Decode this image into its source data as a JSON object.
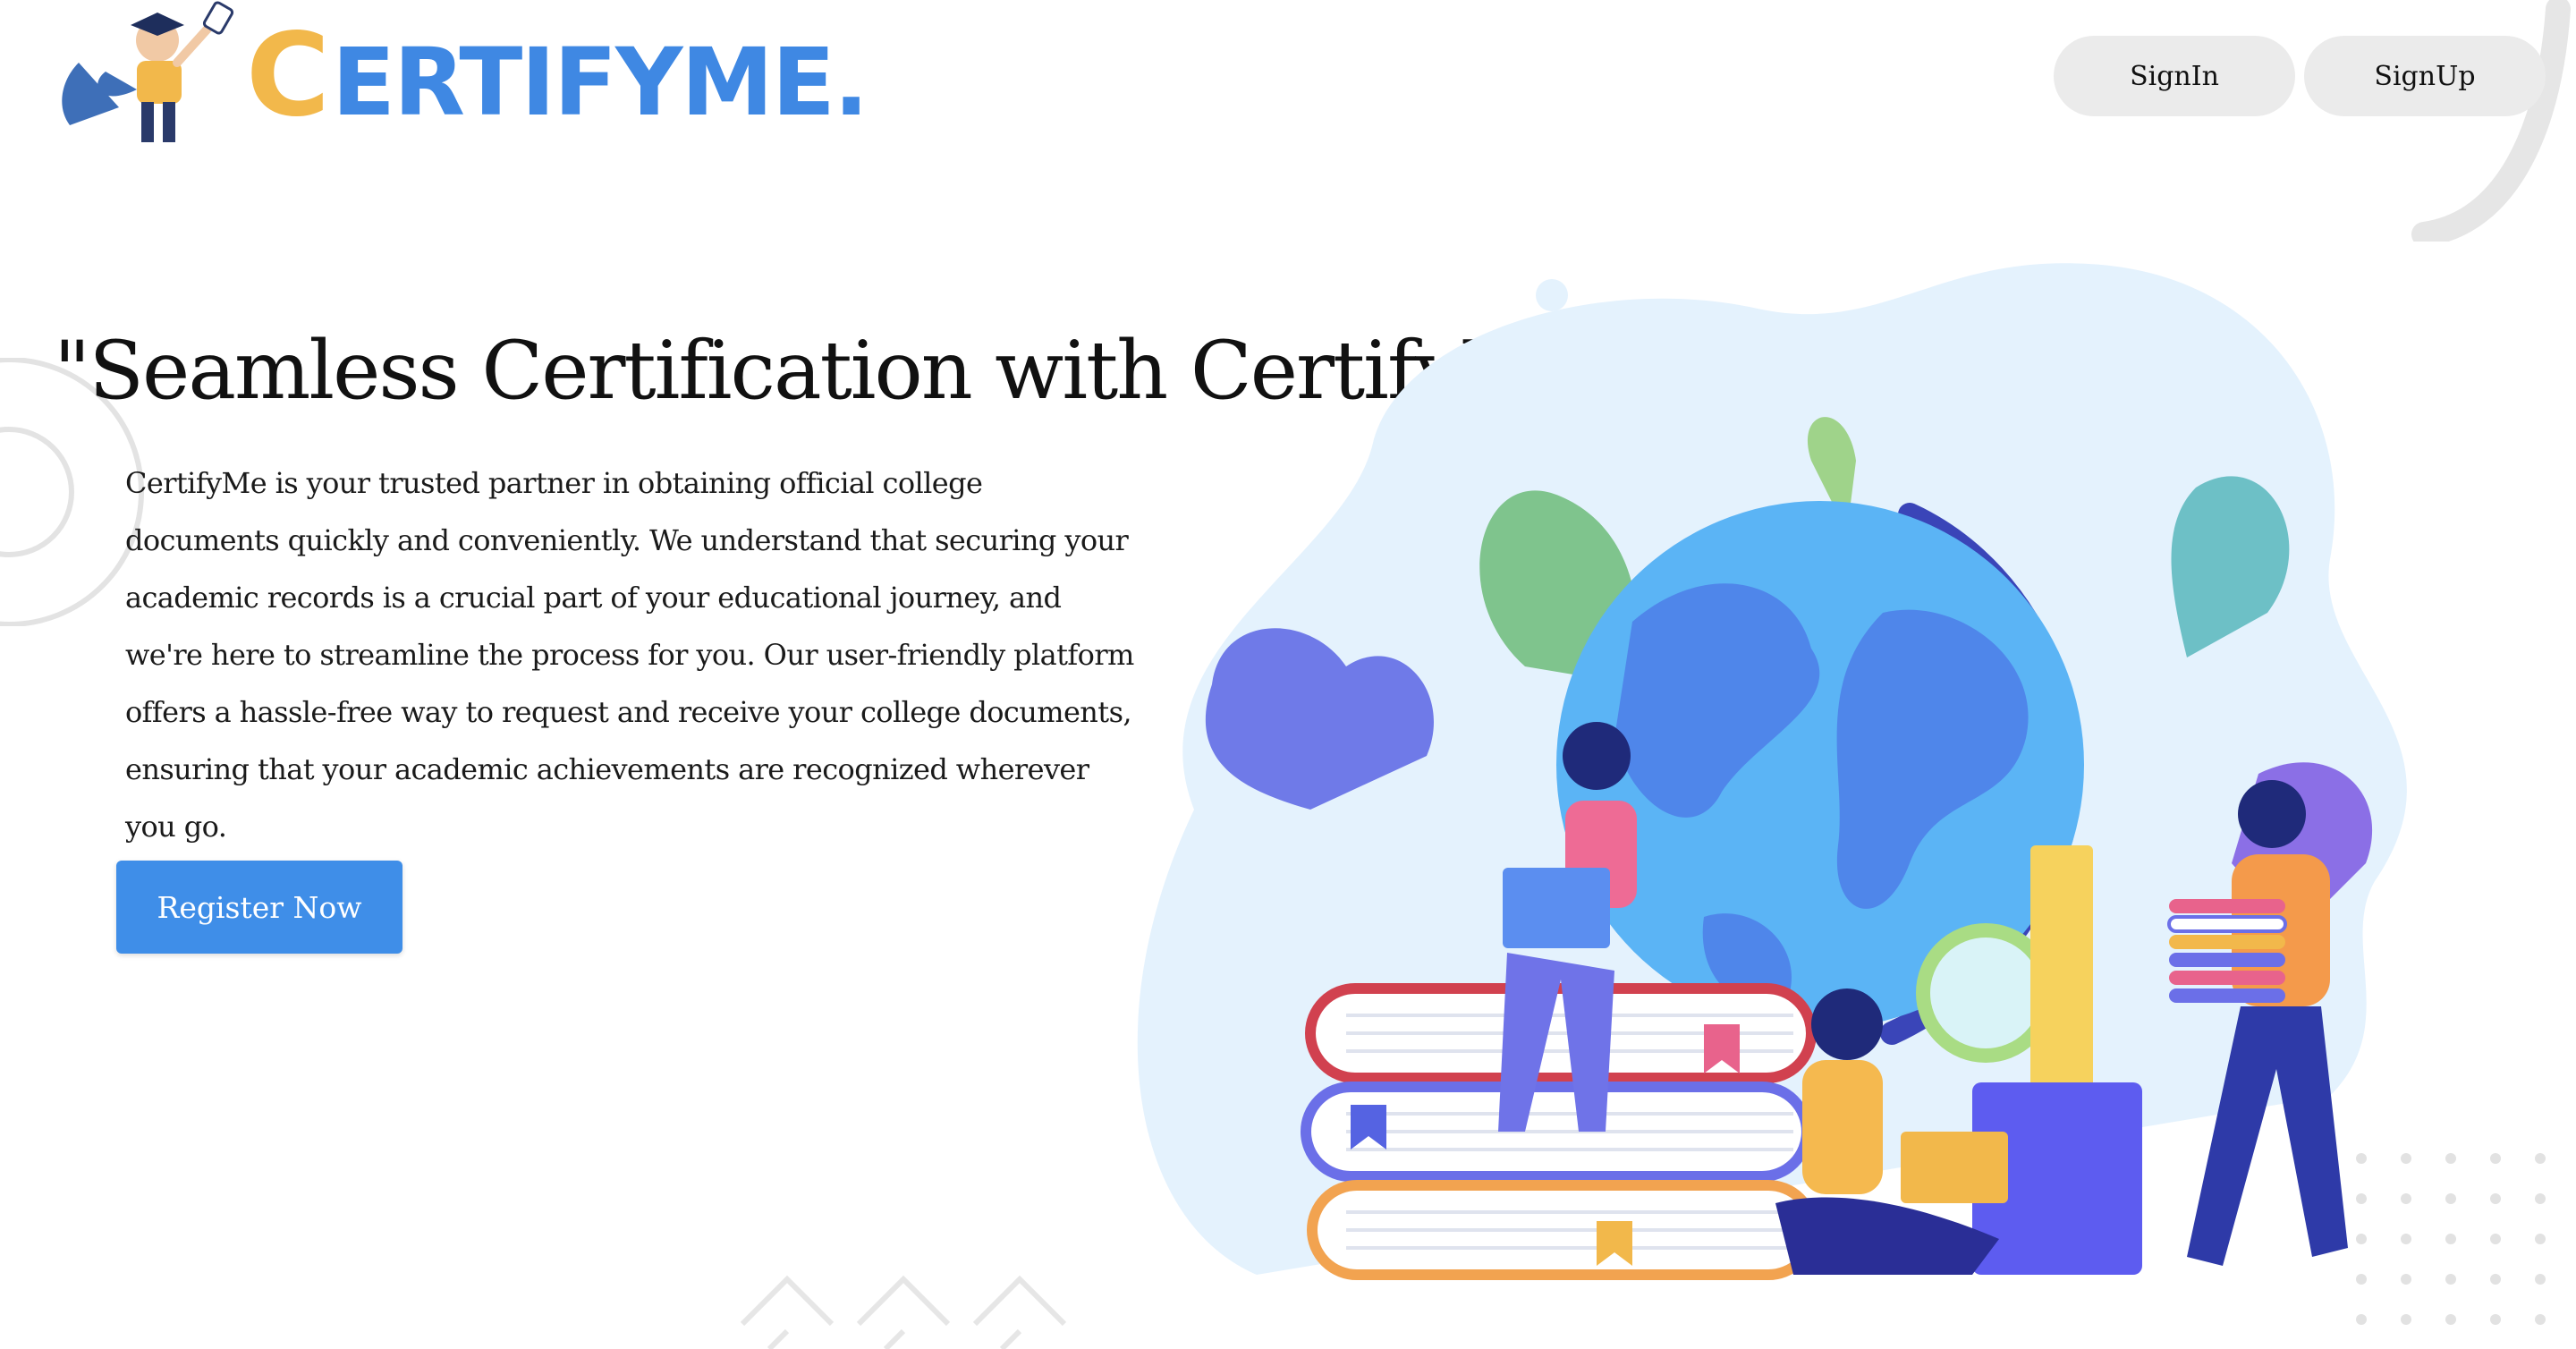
{
  "brand": {
    "logo_text": "ERTIFYME",
    "logo_initial": "C",
    "logo_dot": ".",
    "colors": {
      "primary": "#3f88e3",
      "accent": "#f2b84b"
    }
  },
  "nav": {
    "signin_label": "SignIn",
    "signup_label": "SignUp"
  },
  "hero": {
    "title": "\"Seamless Certification with CertifyMe\"",
    "description": "CertifyMe is your trusted partner in obtaining official college documents quickly and conveniently. We understand that securing your academic records is a crucial part of your educational journey, and we're here to streamline the process for you. Our user-friendly platform offers a hassle-free way to request and receive your college documents, ensuring that your academic achievements are recognized wherever you go.",
    "cta_label": "Register Now",
    "cta_color": "#3f8ee8"
  },
  "icons": {
    "logo_mascot": "graduate-mascot-icon",
    "illustration": "students-globe-books-illustration"
  }
}
